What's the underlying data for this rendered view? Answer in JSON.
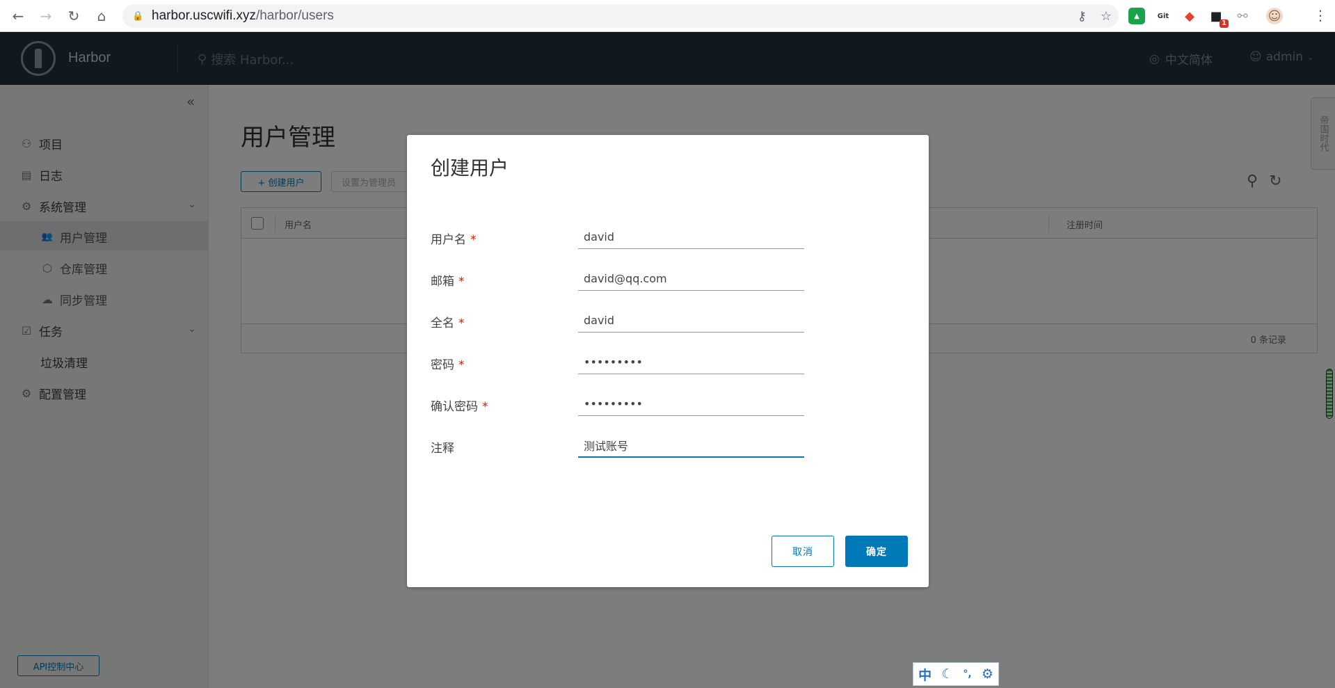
{
  "browser": {
    "url_host": "harbor.uscwifi.xyz",
    "url_path": "/harbor/users",
    "back_icon": "←",
    "forward_icon": "→",
    "reload_icon": "↻",
    "home_icon": "⌂",
    "menu_icon": "⋮",
    "extensions": [
      {
        "name": "shield",
        "label": "▲",
        "color": "#1aa34a"
      },
      {
        "name": "gitzip",
        "label": "Git",
        "color": "#444444"
      },
      {
        "name": "gitlab",
        "label": "◆",
        "color": "#e24329"
      },
      {
        "name": "notify",
        "label": "■",
        "color": "#202124",
        "badge": "1"
      },
      {
        "name": "bike",
        "label": "⚯",
        "color": "#9aa0a6"
      },
      {
        "name": "avatar",
        "label": "☺",
        "color": "#e0c0a0"
      }
    ]
  },
  "header": {
    "app_name": "Harbor",
    "search_placeholder": "搜索 Harbor...",
    "language": "中文简体",
    "user": "admin"
  },
  "sidebar": {
    "items": [
      {
        "label": "项目",
        "icon": "⚇"
      },
      {
        "label": "日志",
        "icon": "▤"
      },
      {
        "label": "系统管理",
        "icon": "⚙"
      },
      {
        "label": "用户管理",
        "icon": "👥"
      },
      {
        "label": "仓库管理",
        "icon": "⬡"
      },
      {
        "label": "同步管理",
        "icon": "☁"
      },
      {
        "label": "任务",
        "icon": "☑"
      },
      {
        "label": "垃圾清理",
        "icon": ""
      },
      {
        "label": "配置管理",
        "icon": "⚙"
      }
    ],
    "api_button": "API控制中心"
  },
  "content": {
    "title": "用户管理",
    "create_user_button": "+ 创建用户",
    "set_admin_button": "设置为管理员",
    "columns": [
      "用户名",
      "注册时间"
    ],
    "record_count": "0 条记录"
  },
  "side_tab": "帝国时代",
  "modal": {
    "title": "创建用户",
    "fields": [
      {
        "label": "用户名",
        "required": true,
        "value": "david"
      },
      {
        "label": "邮箱",
        "required": true,
        "value": "david@qq.com"
      },
      {
        "label": "全名",
        "required": true,
        "value": "david"
      },
      {
        "label": "密码",
        "required": true,
        "value": "•••••••••"
      },
      {
        "label": "确认密码",
        "required": true,
        "value": "•••••••••"
      },
      {
        "label": "注释",
        "required": false,
        "value": "测试账号"
      }
    ],
    "cancel_label": "取消",
    "ok_label": "确定"
  },
  "ime": [
    "中",
    "☾",
    "°,",
    "⚙"
  ],
  "colors": {
    "accent": "#0079b8",
    "header_bg": "#25333d",
    "required": "#c92100"
  }
}
